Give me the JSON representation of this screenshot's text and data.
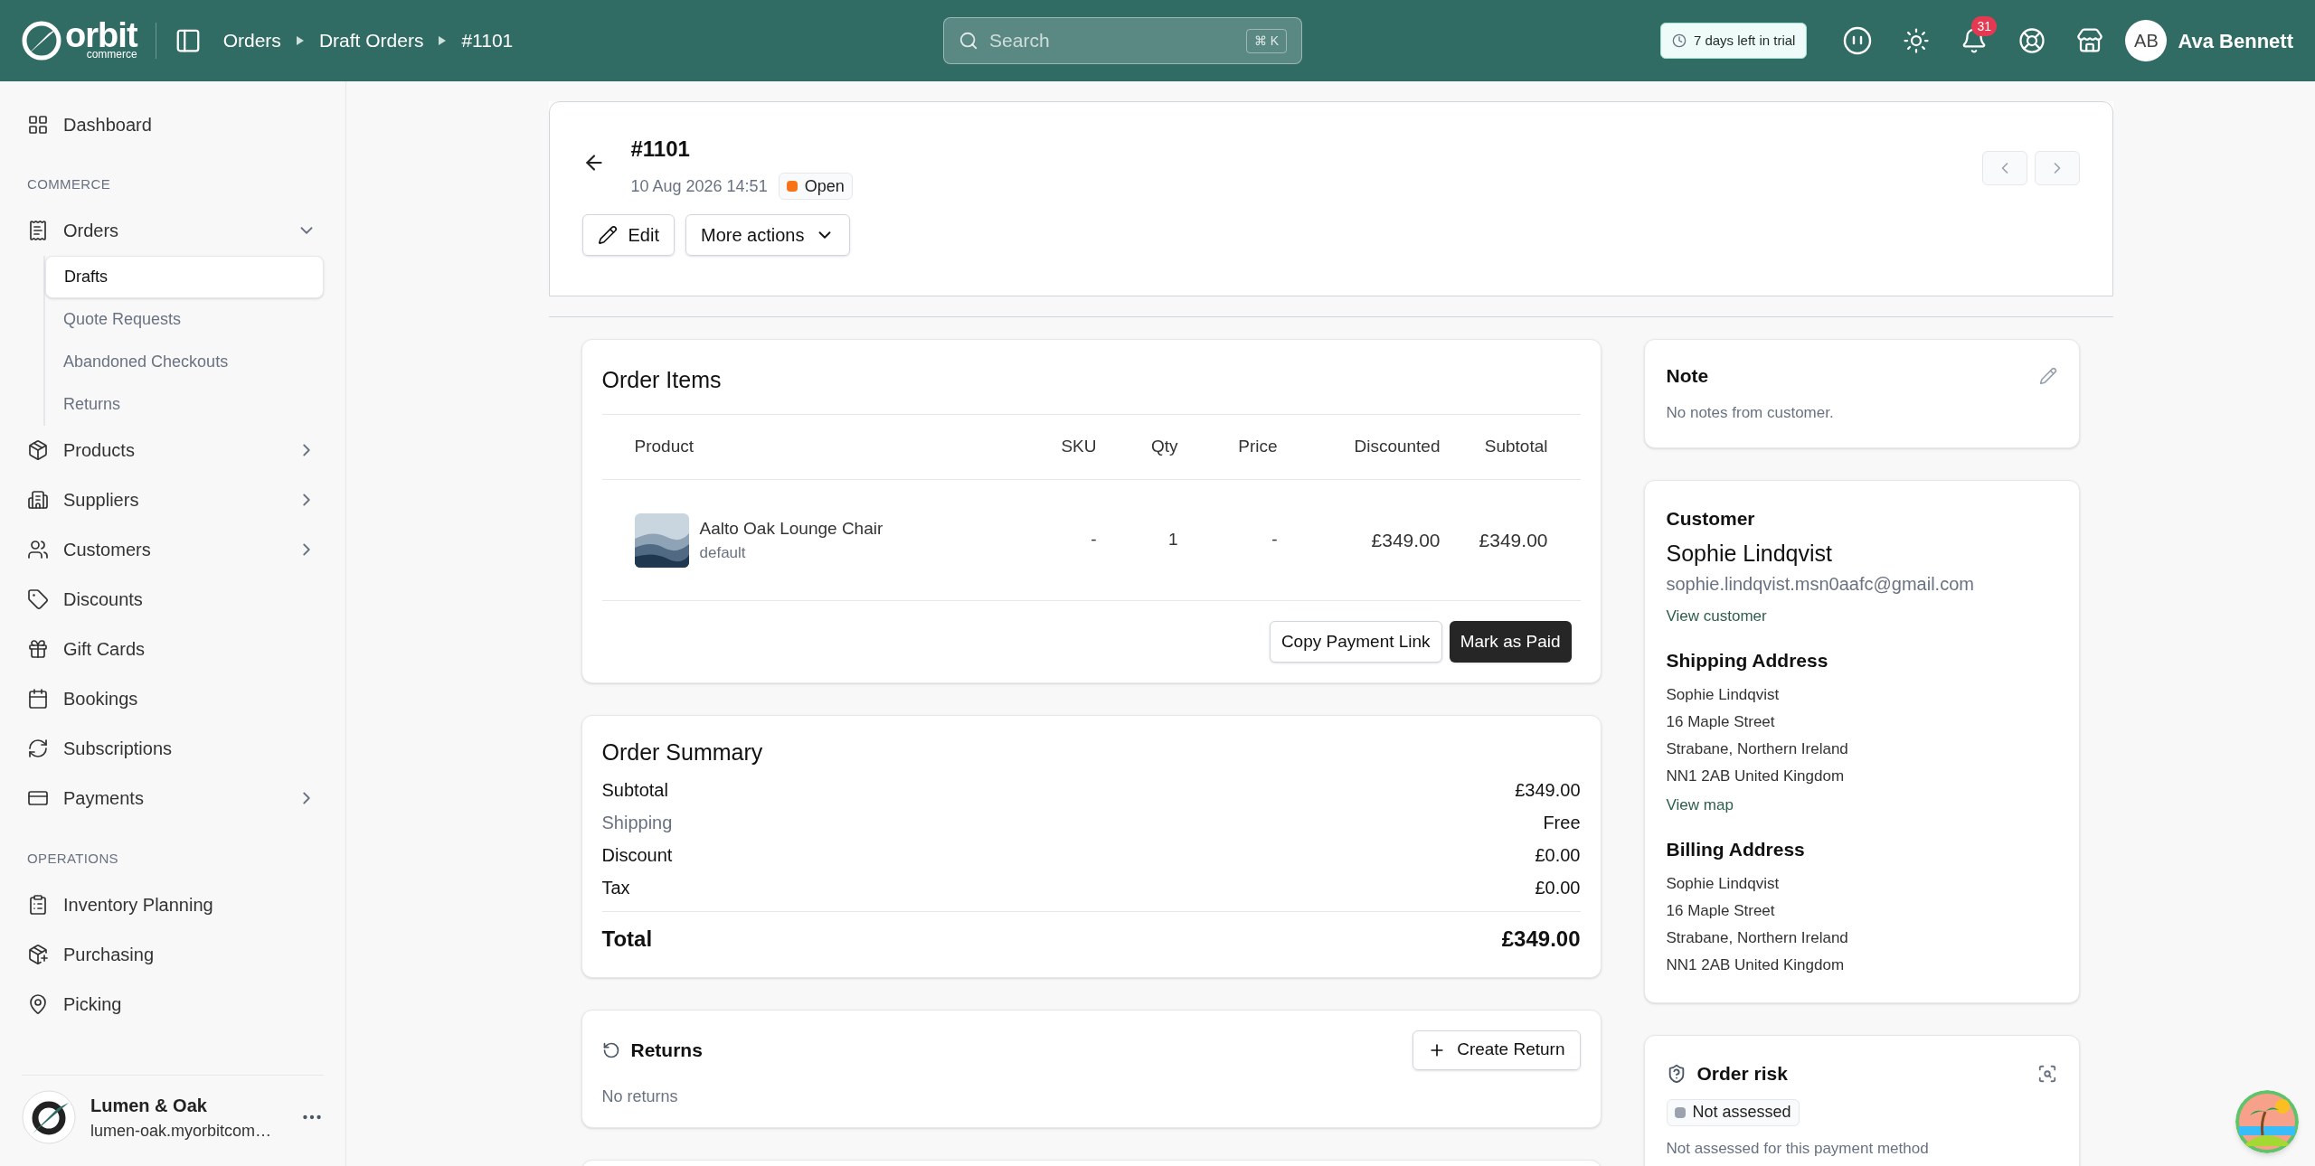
{
  "topbar": {
    "logo": {
      "name": "orbit",
      "tagline": "commerce"
    },
    "breadcrumbs": [
      "Orders",
      "Draft Orders",
      "#1101"
    ],
    "search": {
      "placeholder": "Search",
      "shortcut": "⌘ K"
    },
    "trial": "7 days left in trial",
    "notifications": "31",
    "user": {
      "initials": "AB",
      "name": "Ava Bennett"
    }
  },
  "sidebar": {
    "sections": [
      {
        "items": [
          {
            "label": "Dashboard"
          }
        ]
      },
      {
        "heading": "COMMERCE",
        "items": [
          {
            "label": "Orders",
            "expanded": true,
            "children": [
              {
                "label": "Drafts",
                "selected": true
              },
              {
                "label": "Quote Requests",
                "selected": false
              },
              {
                "label": "Abandoned Checkouts",
                "selected": false
              },
              {
                "label": "Returns",
                "selected": false
              }
            ]
          },
          {
            "label": "Products",
            "expanded": false
          },
          {
            "label": "Suppliers",
            "expanded": false
          },
          {
            "label": "Customers",
            "expanded": false
          },
          {
            "label": "Discounts"
          },
          {
            "label": "Gift Cards"
          },
          {
            "label": "Bookings"
          },
          {
            "label": "Subscriptions"
          },
          {
            "label": "Payments",
            "expanded": false
          }
        ]
      },
      {
        "heading": "OPERATIONS",
        "items": [
          {
            "label": "Inventory Planning"
          },
          {
            "label": "Purchasing"
          },
          {
            "label": "Picking"
          }
        ]
      }
    ],
    "store": {
      "name": "Lumen & Oak",
      "url": "lumen-oak.myorbitcom…"
    }
  },
  "order": {
    "number": "#1101",
    "date": "10 Aug 2026 14:51",
    "status": {
      "label": "Open",
      "color": "#f97316"
    },
    "actions": [
      "Edit",
      "More actions"
    ]
  },
  "items": {
    "title": "Order Items",
    "columns": [
      "Product",
      "SKU",
      "Qty",
      "Price",
      "Discounted",
      "Subtotal"
    ],
    "rows": [
      {
        "product": "Aalto Oak Lounge Chair",
        "variant": "default",
        "sku": "-",
        "qty": "1",
        "price": "-",
        "discounted": "£349.00",
        "subtotal": "£349.00"
      }
    ],
    "buttons": [
      {
        "label": "Copy Payment Link",
        "kind": "secondary"
      },
      {
        "label": "Mark as Paid",
        "kind": "primary"
      }
    ]
  },
  "summary": {
    "title": "Order Summary",
    "lines": [
      {
        "label": "Subtotal",
        "value": "£349.00",
        "muted": false
      },
      {
        "label": "Shipping",
        "value": "Free",
        "muted": true
      },
      {
        "label": "Discount",
        "value": "£0.00",
        "muted": false
      },
      {
        "label": "Tax",
        "value": "£0.00",
        "muted": false
      }
    ],
    "total": {
      "label": "Total",
      "value": "£349.00"
    }
  },
  "returns": {
    "title": "Returns",
    "button": "Create Return",
    "empty": "No returns"
  },
  "note": {
    "title": "Note",
    "text": "No notes from customer."
  },
  "customer": {
    "title": "Customer",
    "name": "Sophie Lindqvist",
    "email": "sophie.lindqvist.msn0aafc@gmail.com",
    "link": "View customer",
    "shipping": {
      "title": "Shipping Address",
      "lines": [
        "Sophie Lindqvist",
        "16 Maple Street",
        "Strabane, Northern Ireland",
        "NN1 2AB United Kingdom"
      ],
      "link": "View map"
    },
    "billing": {
      "title": "Billing Address",
      "lines": [
        "Sophie Lindqvist",
        "16 Maple Street",
        "Strabane, Northern Ireland",
        "NN1 2AB United Kingdom"
      ]
    }
  },
  "risk": {
    "title": "Order risk",
    "status": {
      "label": "Not assessed",
      "color": "#9ca3af"
    },
    "text": "Not assessed for this payment method"
  }
}
